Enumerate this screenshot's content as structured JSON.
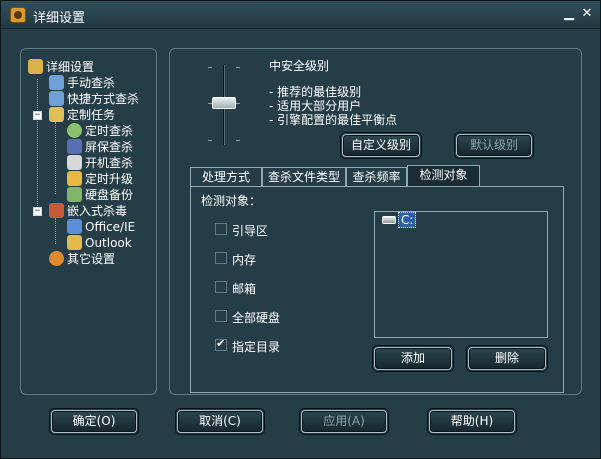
{
  "window": {
    "title": "详细设置",
    "minimize_icon": "minimize-icon",
    "close_icon": "close-icon"
  },
  "tree": {
    "root": "详细设置",
    "manual_scan": "手动查杀",
    "shortcut_scan": "快捷方式查杀",
    "scheduled_tasks": "定制任务",
    "timed_scan": "定时查杀",
    "screensaver_scan": "屏保查杀",
    "startup_scan": "开机查杀",
    "timed_upgrade": "定时升级",
    "disk_backup": "硬盘备份",
    "embedded_scan": "嵌入式杀毒",
    "office_ie": "Office/IE",
    "outlook": "Outlook",
    "other_settings": "其它设置",
    "expander_minus": "−"
  },
  "security_level": {
    "title": "中安全级别",
    "lines": [
      "- 推荐的最佳级别",
      "- 适用大部分用户",
      "- 引擎配置的最佳平衡点"
    ],
    "custom_button": "自定义级别",
    "default_button": "默认级别"
  },
  "tabs": [
    "处理方式",
    "查杀文件类型",
    "查杀频率",
    "检测对象"
  ],
  "active_tab": "检测对象",
  "detection": {
    "label": "检测对象：",
    "options": [
      {
        "label": "引导区",
        "checked": false
      },
      {
        "label": "内存",
        "checked": false
      },
      {
        "label": "邮箱",
        "checked": false
      },
      {
        "label": "全部硬盘",
        "checked": false
      },
      {
        "label": "指定目录",
        "checked": true
      }
    ],
    "directories": [
      "C:"
    ],
    "add_button": "添加",
    "delete_button": "删除"
  },
  "footer": {
    "ok": "确定(O)",
    "cancel": "取消(C)",
    "apply": "应用(A)",
    "help": "帮助(H)"
  },
  "colors": {
    "window_bg": "#253d46",
    "border": "#8fa9b3",
    "selected": "#2f5fa8"
  }
}
